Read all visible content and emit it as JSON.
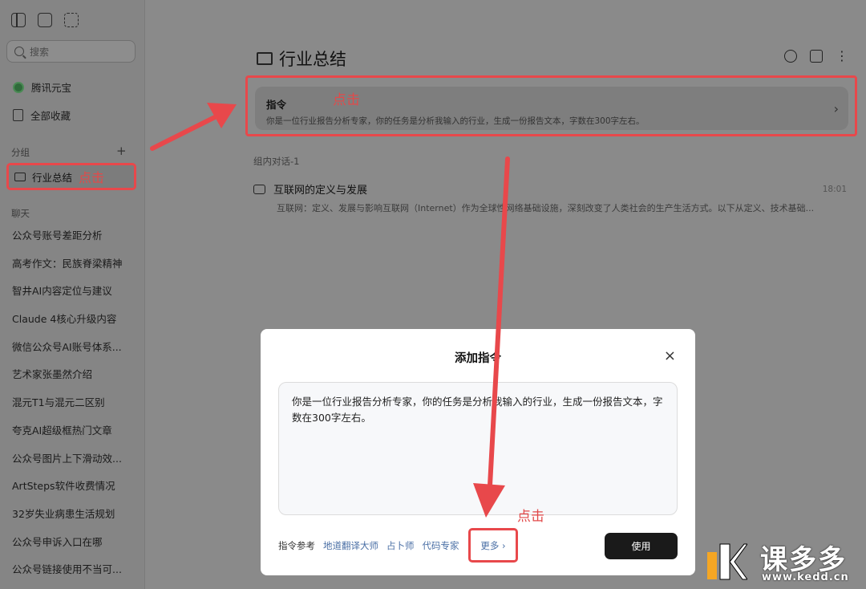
{
  "sidebar": {
    "search_placeholder": "搜索",
    "nav": [
      {
        "label": "腾讯元宝",
        "icon": "yuanbao-logo"
      },
      {
        "label": "全部收藏",
        "icon": "bookmark-icon"
      }
    ],
    "group_section_label": "分组",
    "group_add": "+",
    "group_item": {
      "label": "行业总结",
      "annotation": "点击"
    },
    "chat_section_label": "聊天",
    "chats": [
      "公众号账号差距分析",
      "高考作文：民族脊梁精神",
      "智井AI内容定位与建议",
      "Claude 4核心升级内容",
      "微信公众号AI账号体系...",
      "艺术家张墨然介绍",
      "混元T1与混元二区别",
      "夸克AI超级框热门文章",
      "公众号图片上下滑动效...",
      "ArtSteps软件收费情况",
      "32岁失业病患生活规划",
      "公众号申诉入口在哪",
      "公众号链接使用不当可..."
    ]
  },
  "main": {
    "title": "行业总结",
    "instruction": {
      "title": "指令",
      "annotation": "点击",
      "desc": "你是一位行业报告分析专家，你的任务是分析我输入的行业，生成一份报告文本，字数在300字左右。",
      "chevron": "›"
    },
    "conversation_label": "组内对话-1",
    "conversation": {
      "title": "互联网的定义与发展",
      "time": "18:01",
      "preview": "互联网：定义、发展与影响互联网（Internet）作为全球性网络基础设施，深刻改变了人类社会的生产生活方式。以下从定义、技术基础..."
    }
  },
  "modal": {
    "title": "添加指令",
    "close": "×",
    "text": "你是一位行业报告分析专家，你的任务是分析我输入的行业，生成一份报告文本，字数在300字左右。",
    "ref_label": "指令参考",
    "refs": [
      "地道翻译大师",
      "占卜师",
      "代码专家"
    ],
    "more": "更多 ›",
    "more_annotation": "点击",
    "use_button": "使用"
  },
  "watermark": {
    "text": "课多多",
    "url": "www.kedd.cn"
  },
  "colors": {
    "annotation_red": "#e8484b",
    "link_blue": "#4a6fa5",
    "button_dark": "#1a1a1a"
  }
}
